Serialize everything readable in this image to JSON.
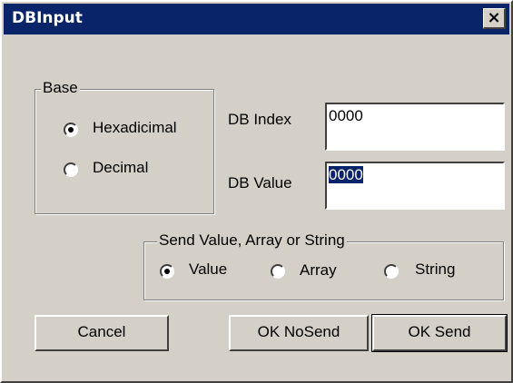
{
  "window": {
    "title": "DBInput",
    "close_glyph": "×"
  },
  "base_group": {
    "label": "Base",
    "options": [
      {
        "label": "Hexadicimal",
        "selected": true
      },
      {
        "label": "Decimal",
        "selected": false
      }
    ]
  },
  "db_index": {
    "label": "DB Index",
    "value": "0000"
  },
  "db_value": {
    "label": "DB Value",
    "value": "0000"
  },
  "send_group": {
    "label": "Send  Value,  Array or String",
    "options": [
      {
        "label": "Value",
        "selected": true
      },
      {
        "label": "Array",
        "selected": false
      },
      {
        "label": "String",
        "selected": false
      }
    ]
  },
  "buttons": {
    "cancel": "Cancel",
    "ok_nosend": "OK NoSend",
    "ok_send": "OK Send"
  }
}
